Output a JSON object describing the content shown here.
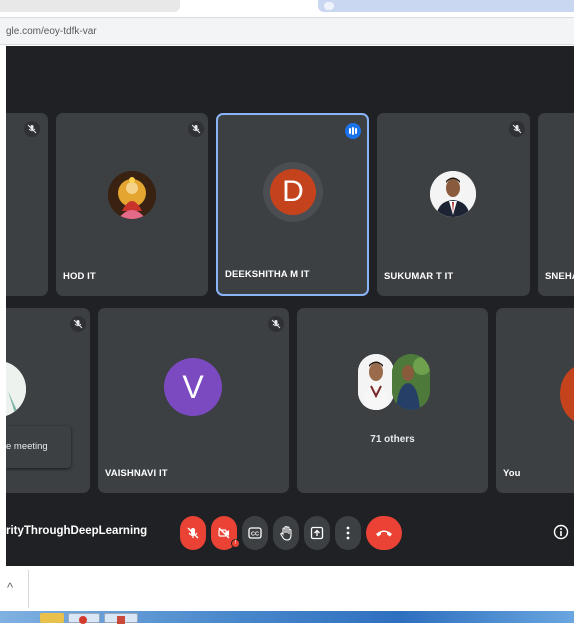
{
  "browser": {
    "url": "gle.com/eoy-tdfk-var"
  },
  "tiles": {
    "partial_left_top": {
      "muted": true
    },
    "hod": {
      "name": "HOD IT",
      "muted": true
    },
    "deekshitha": {
      "name": "DEEKSHITHA M IT",
      "initial": "D",
      "speaking": true
    },
    "sukumar": {
      "name": "SUKUMAR T IT",
      "muted": true
    },
    "sneha": {
      "name": "SNEHA"
    },
    "partial_left_bottom": {
      "muted": true
    },
    "vaishnavi": {
      "name": "VAISHNAVI IT",
      "initial": "V",
      "muted": true
    },
    "others": {
      "label": "71 others"
    },
    "you": {
      "name": "You"
    }
  },
  "toast": {
    "text": "e meeting"
  },
  "bottombar": {
    "meeting_title": "rityThroughDeepLearning",
    "controls": [
      "mic-off-icon",
      "camera-off-icon",
      "captions-icon",
      "raise-hand-icon",
      "present-icon",
      "more-options-icon",
      "end-call-icon"
    ],
    "info_icon": "info-icon"
  },
  "colors": {
    "background": "#202124",
    "tile": "#3c4043",
    "active_border": "#8ab4f8",
    "danger": "#ea4335",
    "avatar_d": "#c5431c",
    "avatar_v": "#7b4ac0",
    "speaking": "#1a73e8"
  }
}
